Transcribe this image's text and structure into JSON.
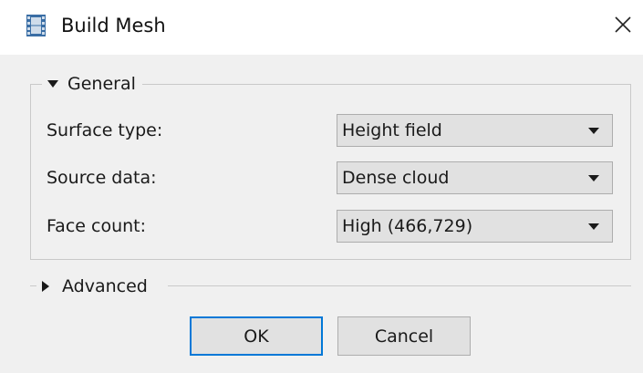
{
  "window": {
    "title": "Build Mesh",
    "icon": "film-strip-icon",
    "close_icon": "close-icon"
  },
  "general": {
    "label": "General",
    "expanded": true,
    "rows": [
      {
        "label": "Surface type:",
        "value": "Height field"
      },
      {
        "label": "Source data:",
        "value": "Dense cloud"
      },
      {
        "label": "Face count:",
        "value": "High (466,729)"
      }
    ]
  },
  "advanced": {
    "label": "Advanced",
    "expanded": false
  },
  "buttons": {
    "ok_label": "OK",
    "cancel_label": "Cancel"
  },
  "colors": {
    "body_bg": "#f0f0f0",
    "titlebar_bg": "#ffffff",
    "combo_bg": "#e1e1e1",
    "focus_border": "#0078d7",
    "icon_blue": "#3a6ea5"
  }
}
